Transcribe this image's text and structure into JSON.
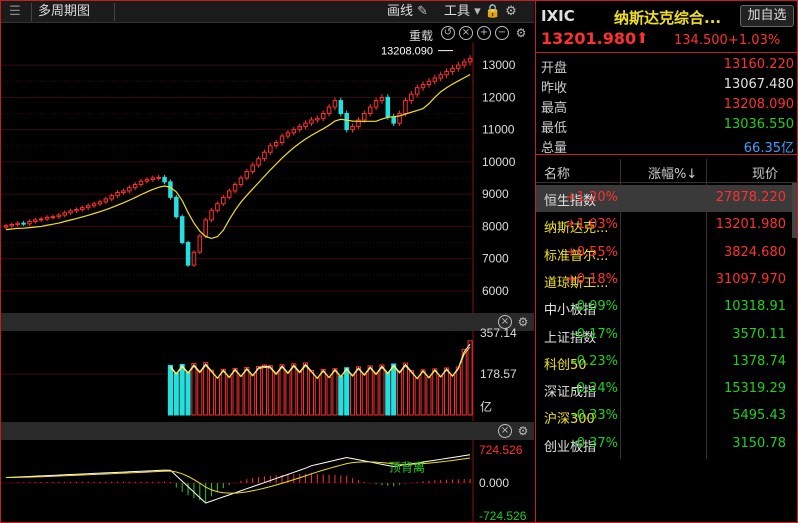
{
  "toolbar": {
    "period_label": "多周期图",
    "draw_label": "画线",
    "tools_label": "工具"
  },
  "kline": {
    "reset_label": "重载",
    "high_marker": "13208.090",
    "y_ticks": [
      "13000",
      "12000",
      "11000",
      "10000",
      "9000",
      "8000",
      "7000",
      "6000"
    ]
  },
  "volume": {
    "y_ticks": [
      "357.14",
      "178.57",
      "亿"
    ]
  },
  "macd": {
    "y_ticks": [
      "724.526",
      "0.000",
      "-724.526"
    ],
    "annotation": "顶背离"
  },
  "quote": {
    "symbol": "IXIC",
    "name": "纳斯达克综合...",
    "add_watch": "加自选",
    "last": "13201.980",
    "change": "134.500",
    "change_pct": "+1.03%",
    "stats": [
      {
        "label": "开盘",
        "value": "13160.220",
        "tone": "up"
      },
      {
        "label": "昨收",
        "value": "13067.480",
        "tone": "neutral"
      },
      {
        "label": "最高",
        "value": "13208.090",
        "tone": "up"
      },
      {
        "label": "最低",
        "value": "13036.550",
        "tone": "down"
      },
      {
        "label": "总量",
        "value": "66.35亿",
        "tone": "blue"
      }
    ]
  },
  "index_list": {
    "col_name": "名称",
    "col_pct": "涨幅%↓",
    "col_price": "现价",
    "rows": [
      {
        "name": "恒生指数",
        "pct": "+1.20%",
        "price": "27878.220",
        "tone": "up",
        "name_tone": "whitename"
      },
      {
        "name": "纳斯达克...",
        "pct": "+1.03%",
        "price": "13201.980",
        "tone": "up",
        "name_tone": "yellowname"
      },
      {
        "name": "标准普尔...",
        "pct": "+0.55%",
        "price": "3824.680",
        "tone": "up",
        "name_tone": "yellowname"
      },
      {
        "name": "道琼斯工...",
        "pct": "+0.18%",
        "price": "31097.970",
        "tone": "up",
        "name_tone": "yellowname"
      },
      {
        "name": "中小板指",
        "pct": "-0.09%",
        "price": "10318.91",
        "tone": "down",
        "name_tone": "whitename"
      },
      {
        "name": "上证指数",
        "pct": "-0.17%",
        "price": "3570.11",
        "tone": "down",
        "name_tone": "whitename"
      },
      {
        "name": "科创50",
        "pct": "-0.23%",
        "price": "1378.74",
        "tone": "down",
        "name_tone": "yellowname"
      },
      {
        "name": "深证成指",
        "pct": "-0.24%",
        "price": "15319.29",
        "tone": "down",
        "name_tone": "whitename"
      },
      {
        "name": "沪深300",
        "pct": "-0.33%",
        "price": "5495.43",
        "tone": "down",
        "name_tone": "yellowname"
      },
      {
        "name": "创业板指",
        "pct": "-0.37%",
        "price": "3150.78",
        "tone": "down",
        "name_tone": "whitename"
      }
    ]
  },
  "chart_data": {
    "type": "candlestick",
    "price_ylim": [
      5500,
      13500
    ],
    "close": [
      8020,
      8060,
      8100,
      8080,
      8150,
      8200,
      8230,
      8280,
      8300,
      8350,
      8420,
      8480,
      8520,
      8580,
      8640,
      8700,
      8760,
      8850,
      8950,
      9050,
      9100,
      9200,
      9300,
      9400,
      9450,
      9500,
      9520,
      9380,
      8900,
      8300,
      7500,
      6800,
      7200,
      7700,
      8200,
      8500,
      8700,
      8900,
      9100,
      9300,
      9500,
      9700,
      9900,
      10100,
      10300,
      10500,
      10600,
      10800,
      10900,
      11000,
      11100,
      11200,
      11300,
      11350,
      11500,
      11700,
      11900,
      11500,
      11000,
      11100,
      11300,
      11500,
      11700,
      11900,
      12000,
      11400,
      11200,
      11500,
      11900,
      12100,
      12300,
      12400,
      12500,
      12600,
      12700,
      12800,
      12900,
      13000,
      13100,
      13201
    ],
    "volume_ylim": [
      0,
      357.14
    ],
    "macd_ylim": [
      -724.526,
      724.526
    ]
  }
}
